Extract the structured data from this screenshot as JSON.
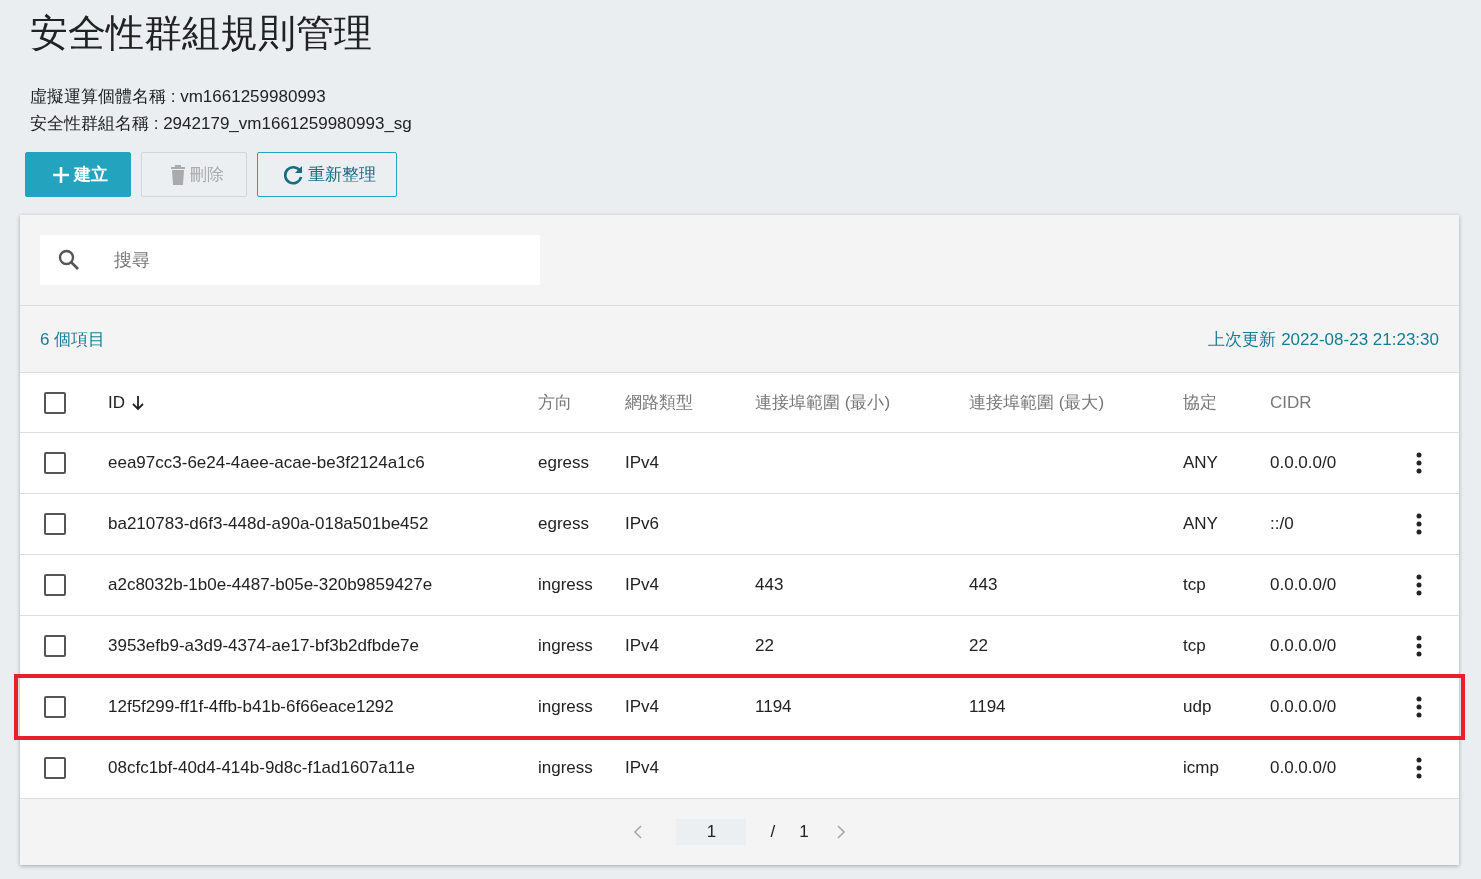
{
  "title": "安全性群組規則管理",
  "info": [
    "虛擬運算個體名稱 : vm1661259980993",
    "安全性群組名稱 : 2942179_vm1661259980993_sg"
  ],
  "toolbar": [
    {
      "kind": "create",
      "label": "建立",
      "disabled": false
    },
    {
      "kind": "delete",
      "label": "刪除",
      "disabled": true
    },
    {
      "kind": "refresh",
      "label": "重新整理",
      "disabled": false
    }
  ],
  "search": {
    "placeholder": "搜尋"
  },
  "item_count": "6 個項目",
  "last_updated": "上次更新 2022-08-23 21:23:30",
  "table": {
    "select_all_checked": false,
    "columns": [
      {
        "label": "ID",
        "sorted": true
      },
      {
        "label": "方向",
        "sorted": false
      },
      {
        "label": "網路類型",
        "sorted": false
      },
      {
        "label": "連接埠範圍 (最小)",
        "sorted": false
      },
      {
        "label": "連接埠範圍 (最大)",
        "sorted": false
      },
      {
        "label": "協定",
        "sorted": false
      },
      {
        "label": "CIDR",
        "sorted": false
      }
    ],
    "rows": [
      {
        "checked": false,
        "highlighted": false,
        "cells": [
          "eea97cc3-6e24-4aee-acae-be3f2124a1c6",
          "egress",
          "IPv4",
          "",
          "",
          "ANY",
          "0.0.0.0/0"
        ]
      },
      {
        "checked": false,
        "highlighted": false,
        "cells": [
          "ba210783-d6f3-448d-a90a-018a501be452",
          "egress",
          "IPv6",
          "",
          "",
          "ANY",
          "::/0"
        ]
      },
      {
        "checked": false,
        "highlighted": false,
        "cells": [
          "a2c8032b-1b0e-4487-b05e-320b9859427e",
          "ingress",
          "IPv4",
          "443",
          "443",
          "tcp",
          "0.0.0.0/0"
        ]
      },
      {
        "checked": false,
        "highlighted": false,
        "cells": [
          "3953efb9-a3d9-4374-ae17-bf3b2dfbde7e",
          "ingress",
          "IPv4",
          "22",
          "22",
          "tcp",
          "0.0.0.0/0"
        ]
      },
      {
        "checked": false,
        "highlighted": true,
        "cells": [
          "12f5f299-ff1f-4ffb-b41b-6f66eace1292",
          "ingress",
          "IPv4",
          "1194",
          "1194",
          "udp",
          "0.0.0.0/0"
        ]
      },
      {
        "checked": false,
        "highlighted": false,
        "cells": [
          "08cfc1bf-40d4-414b-9d8c-f1ad1607a11e",
          "ingress",
          "IPv4",
          "",
          "",
          "icmp",
          "0.0.0.0/0"
        ]
      }
    ]
  },
  "pagination": {
    "current": "1",
    "separator": "/",
    "total": "1"
  }
}
